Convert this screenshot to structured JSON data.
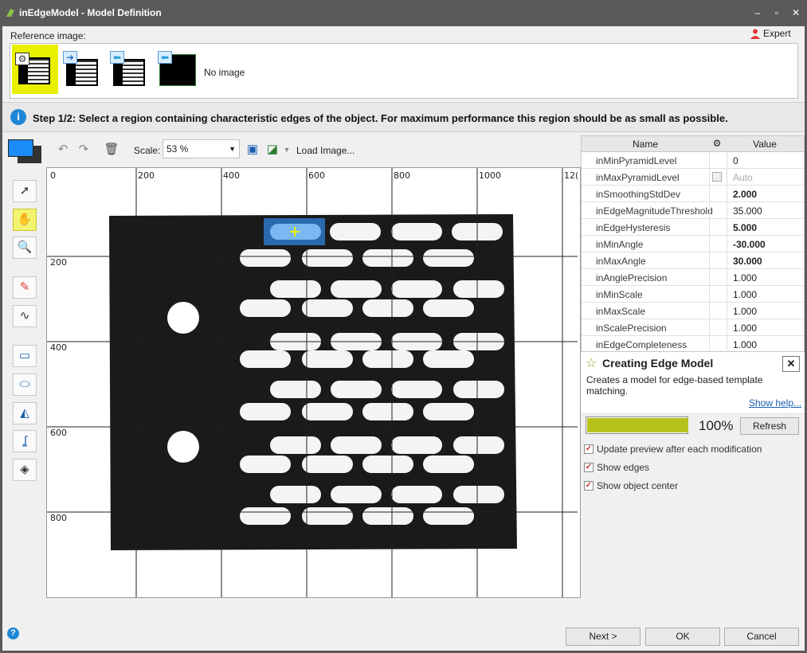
{
  "window": {
    "title": "inEdgeModel - Model Definition"
  },
  "reference": {
    "label": "Reference image:",
    "expert": "Expert",
    "no_image": "No image"
  },
  "step": {
    "text": "Step 1/2: Select a region containing characteristic edges of the object. For maximum performance this region should be as small as possible."
  },
  "toolbar": {
    "scale_label": "Scale:",
    "scale_value": "53 %",
    "load_image": "Load Image..."
  },
  "canvas": {
    "x_ruler": [
      "0",
      "200",
      "400",
      "600",
      "800",
      "1000",
      "12("
    ],
    "y_ruler": [
      "200",
      "400",
      "600",
      "800"
    ]
  },
  "props": {
    "col_name": "Name",
    "col_value": "Value",
    "rows": [
      {
        "name": "inMinPyramidLevel",
        "value": "0"
      },
      {
        "name": "inMaxPyramidLevel",
        "value": "Auto"
      },
      {
        "name": "inSmoothingStdDev",
        "value": "2.000"
      },
      {
        "name": "inEdgeMagnitudeThreshold",
        "value": "35.000"
      },
      {
        "name": "inEdgeHysteresis",
        "value": "5.000"
      },
      {
        "name": "inMinAngle",
        "value": "-30.000"
      },
      {
        "name": "inMaxAngle",
        "value": "30.000"
      },
      {
        "name": "inAnglePrecision",
        "value": "1.000"
      },
      {
        "name": "inMinScale",
        "value": "1.000"
      },
      {
        "name": "inMaxScale",
        "value": "1.000"
      },
      {
        "name": "inScalePrecision",
        "value": "1.000"
      },
      {
        "name": "inEdgeCompleteness",
        "value": "1.000"
      }
    ]
  },
  "info": {
    "title": "Creating Edge Model",
    "description": "Creates a model for edge-based template matching.",
    "help_link": "Show help..."
  },
  "progress": {
    "percent": 100,
    "text": "100%",
    "refresh": "Refresh"
  },
  "options": [
    {
      "label": "Update preview after each modification",
      "checked": true
    },
    {
      "label": "Show edges",
      "checked": true
    },
    {
      "label": "Show object center",
      "checked": true
    }
  ],
  "buttons": {
    "next": "Next >",
    "ok": "OK",
    "cancel": "Cancel"
  },
  "colors": {
    "accent_yellow": "#e8f000",
    "selection_blue": "#1a8cf7",
    "progress": "#b7c11b"
  }
}
